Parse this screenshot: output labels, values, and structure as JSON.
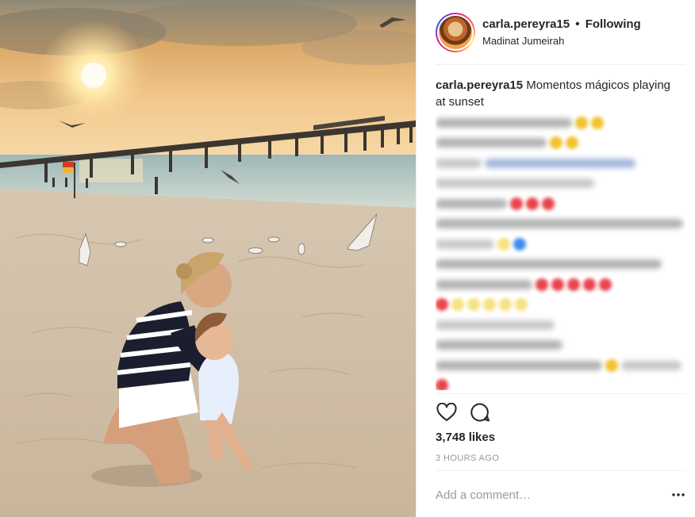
{
  "post": {
    "username": "carla.pereyra15",
    "separator": "•",
    "follow_state": "Following",
    "location": "Madinat Jumeirah",
    "caption_username": "carla.pereyra15",
    "caption_text": " Momentos mágicos playing at sunset",
    "likes": "3,748 likes",
    "timestamp": "3 HOURS AGO",
    "comment_placeholder": "Add a comment…"
  },
  "icons": {
    "like": "heart-icon",
    "comment": "speech-bubble-icon",
    "more": "more-options-icon"
  },
  "colors": {
    "text": "#262626",
    "muted": "#999999",
    "divider": "#efefef"
  }
}
